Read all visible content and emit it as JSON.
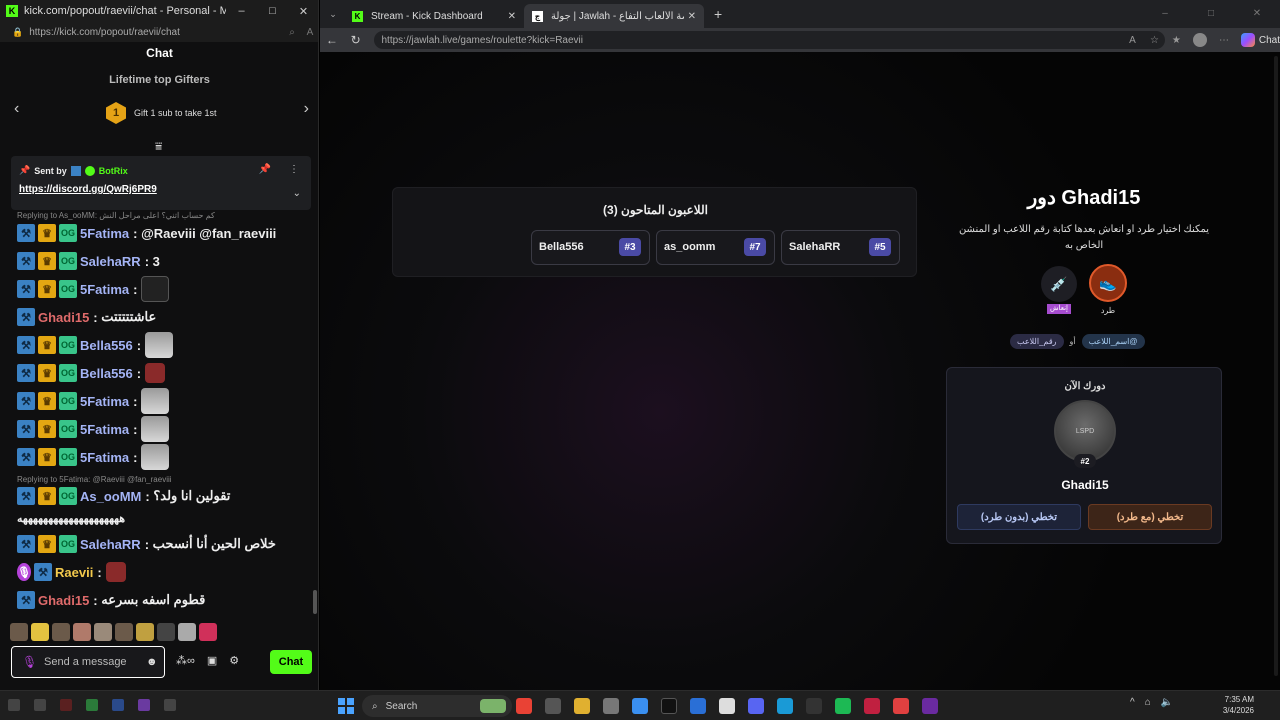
{
  "left_window": {
    "title": "kick.com/popout/raevii/chat - Personal - Micros...",
    "controls": [
      "–",
      "□",
      "✕"
    ],
    "url": "https://kick.com/popout/raevii/chat",
    "chat_header": "Chat",
    "gifters": {
      "title": "Lifetime top Gifters",
      "badge_rank": "1",
      "text": "Gift 1 sub to take 1st"
    },
    "pinned": {
      "sent_by": "Sent by",
      "sender": "BotRix",
      "link": "https://discord.gg/QwRj6PR9"
    },
    "messages": [
      {
        "reply": "Replying to As_ooMM: كم حساب اتني؟ اعلى مراحل النش"
      },
      {
        "user": "5Fatima",
        "color": "#a4b4f5",
        "text": "@Raeviii @fan_raeviii"
      },
      {
        "user": "SalehaRR",
        "color": "#a4b4f5",
        "text": "3"
      },
      {
        "user": "5Fatima",
        "color": "#a4b4f5",
        "text": "",
        "emote": "black"
      },
      {
        "user": "Ghadi15",
        "color": "#e06b6b",
        "text": "عاشتتتتتت"
      },
      {
        "user": "Bella556",
        "color": "#a4b4f5",
        "text": "",
        "emote": "cat"
      },
      {
        "user": "Bella556",
        "color": "#a4b4f5",
        "text": "",
        "emote": "small"
      },
      {
        "user": "5Fatima",
        "color": "#a4b4f5",
        "text": "",
        "emote": "cat"
      },
      {
        "user": "5Fatima",
        "color": "#a4b4f5",
        "text": "",
        "emote": "cat"
      },
      {
        "user": "5Fatima",
        "color": "#a4b4f5",
        "text": "",
        "emote": "cat"
      },
      {
        "reply": "Replying to 5Fatima: @Raeviii @fan_raeviii"
      },
      {
        "user": "As_ooMM",
        "color": "#a4b4f5",
        "text": "تقولين انا ولد؟"
      },
      {
        "wrap": "ههههههههههههههههههههه"
      },
      {
        "user": "SalehaRR",
        "color": "#a4b4f5",
        "text": "خلاص الحين أنا أنسحب"
      },
      {
        "user": "Raevii",
        "color": "#f2c94c",
        "text": "",
        "emote": "small"
      },
      {
        "user": "Ghadi15",
        "color": "#e06b6b",
        "text": "قطوم اسفه بسرعه"
      }
    ],
    "input_placeholder": "Send a message",
    "send_label": "Chat"
  },
  "right_window": {
    "tabs": [
      {
        "title": "Stream - Kick Dashboard",
        "fav_color": "#53fc18",
        "fav": "K"
      },
      {
        "title": "جولة | Jawlah - منصة الألعاب التفاع...",
        "fav_color": "#ffffff",
        "fav": "ج"
      }
    ],
    "url": "https://jawlah.live/games/roulette?kick=Raevii",
    "copilot_label": "Chat",
    "eliminated": {
      "title": "اللاعبون المتاحون (3)",
      "players": [
        {
          "name": "Bella556",
          "num": "#3"
        },
        {
          "name": "as_oomm",
          "num": "#7"
        },
        {
          "name": "SalehaRR",
          "num": "#5"
        }
      ]
    },
    "turn": {
      "title": "دور Ghadi15",
      "desc": "يمكنك اختيار طرد او انعاش بعدها كتابة رقم اللاعب او المنشن الخاص به",
      "kick_label": "طرد",
      "revive_label": "إنعاش",
      "hint_name": "@اسم_اللاعب",
      "hint_or": "أو",
      "hint_num": "رقم_اللاعب"
    },
    "now": {
      "title": "دورك الآن",
      "avatar_text": "LSPD",
      "rank": "#2",
      "name": "Ghadi15",
      "btn_skip_kick": "تخطي (مع طرد)",
      "btn_skip_nokick": "تخطي (بدون طرد)"
    }
  },
  "taskbar": {
    "search": "Search",
    "time": "7:35 AM",
    "date": "3/4/2026"
  }
}
